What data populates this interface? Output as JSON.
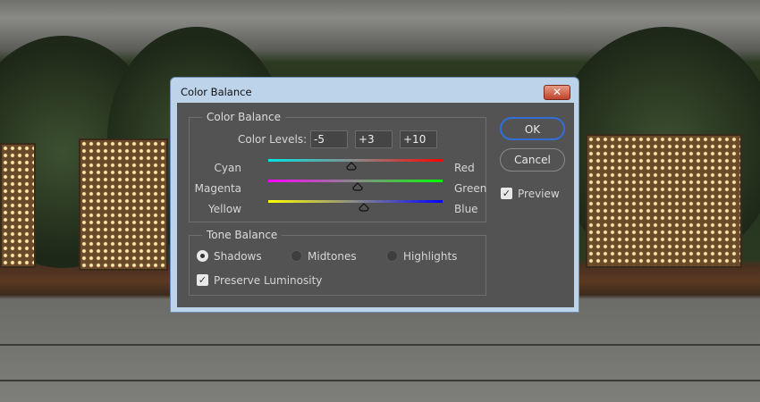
{
  "dialog": {
    "title": "Color Balance",
    "close_icon": "close-icon"
  },
  "color_balance": {
    "legend": "Color Balance",
    "levels_label": "Color Levels:",
    "levels": [
      "-5",
      "+3",
      "+10"
    ],
    "sliders": [
      {
        "left": "Cyan",
        "right": "Red",
        "value": -5,
        "left_color": "#00e5e5",
        "right_color": "#ff0000"
      },
      {
        "left": "Magenta",
        "right": "Green",
        "value": 3,
        "left_color": "#ff00ff",
        "right_color": "#00ff00"
      },
      {
        "left": "Yellow",
        "right": "Blue",
        "value": 10,
        "left_color": "#ffff00",
        "right_color": "#0000ff"
      }
    ]
  },
  "tone_balance": {
    "legend": "Tone Balance",
    "options": [
      "Shadows",
      "Midtones",
      "Highlights"
    ],
    "selected": "Shadows",
    "preserve_luminosity_label": "Preserve Luminosity",
    "preserve_luminosity": true
  },
  "buttons": {
    "ok": "OK",
    "cancel": "Cancel"
  },
  "preview": {
    "label": "Preview",
    "checked": true
  },
  "colors": {
    "dialog_bg": "#535353",
    "titlebar": "#bcd3ea",
    "ok_border": "#2f6fd6"
  }
}
